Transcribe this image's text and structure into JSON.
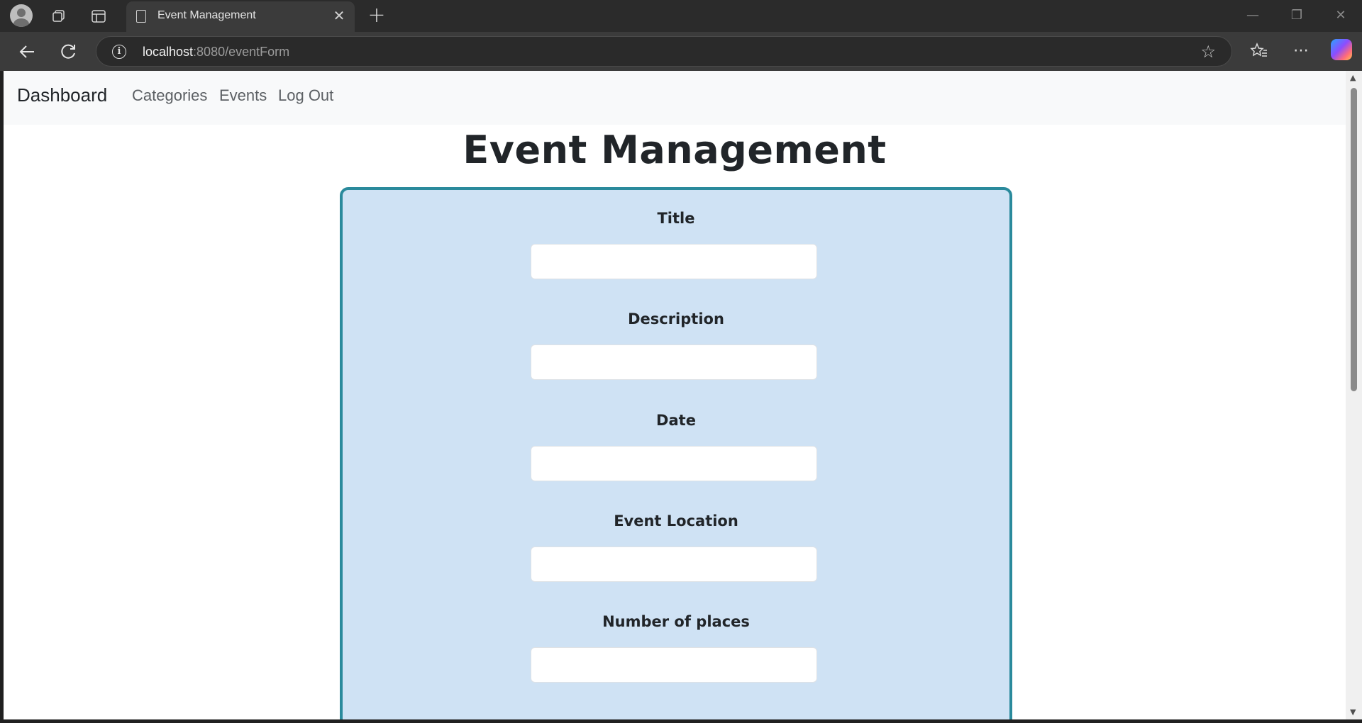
{
  "browser": {
    "tab_title": "Event Management",
    "tab_close": "✕",
    "new_tab": "+",
    "url_host": "localhost",
    "url_path": ":8080/eventForm",
    "window_controls": {
      "minimize": "—",
      "restore": "❐",
      "close": "✕"
    }
  },
  "navbar": {
    "brand": "Dashboard",
    "links": [
      "Categories",
      "Events",
      "Log Out"
    ]
  },
  "page": {
    "title": "Event Management"
  },
  "form": {
    "fields": [
      {
        "label": "Title",
        "value": ""
      },
      {
        "label": "Description",
        "value": ""
      },
      {
        "label": "Date",
        "value": ""
      },
      {
        "label": "Event Location",
        "value": ""
      },
      {
        "label": "Number of places",
        "value": ""
      }
    ]
  },
  "colors": {
    "card_background": "#cfe2f4",
    "card_border": "#2a8a9c",
    "navbar_background": "#f8f9fa"
  }
}
